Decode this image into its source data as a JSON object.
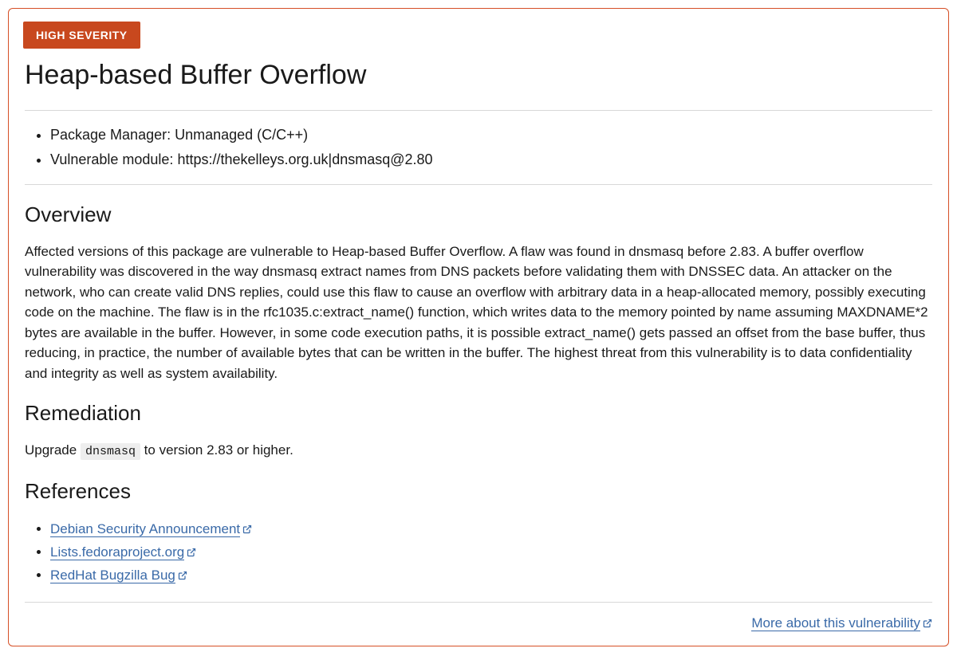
{
  "severity_label": "HIGH SEVERITY",
  "title": "Heap-based Buffer Overflow",
  "meta": {
    "package_manager_label": "Package Manager: ",
    "package_manager_value": "Unmanaged (C/C++)",
    "vulnerable_module_label": "Vulnerable module: ",
    "vulnerable_module_value": "https://thekelleys.org.uk|dnsmasq@2.80"
  },
  "overview": {
    "heading": "Overview",
    "text": "Affected versions of this package are vulnerable to Heap-based Buffer Overflow. A flaw was found in dnsmasq before 2.83. A buffer overflow vulnerability was discovered in the way dnsmasq extract names from DNS packets before validating them with DNSSEC data. An attacker on the network, who can create valid DNS replies, could use this flaw to cause an overflow with arbitrary data in a heap-allocated memory, possibly executing code on the machine. The flaw is in the rfc1035.c:extract_name() function, which writes data to the memory pointed by name assuming MAXDNAME*2 bytes are available in the buffer. However, in some code execution paths, it is possible extract_name() gets passed an offset from the base buffer, thus reducing, in practice, the number of available bytes that can be written in the buffer. The highest threat from this vulnerability is to data confidentiality and integrity as well as system availability."
  },
  "remediation": {
    "heading": "Remediation",
    "prefix": "Upgrade ",
    "code": "dnsmasq",
    "suffix": " to version 2.83 or higher."
  },
  "references": {
    "heading": "References",
    "items": [
      "Debian Security Announcement",
      "Lists.fedoraproject.org",
      "RedHat Bugzilla Bug"
    ]
  },
  "more_link": "More about this vulnerability"
}
